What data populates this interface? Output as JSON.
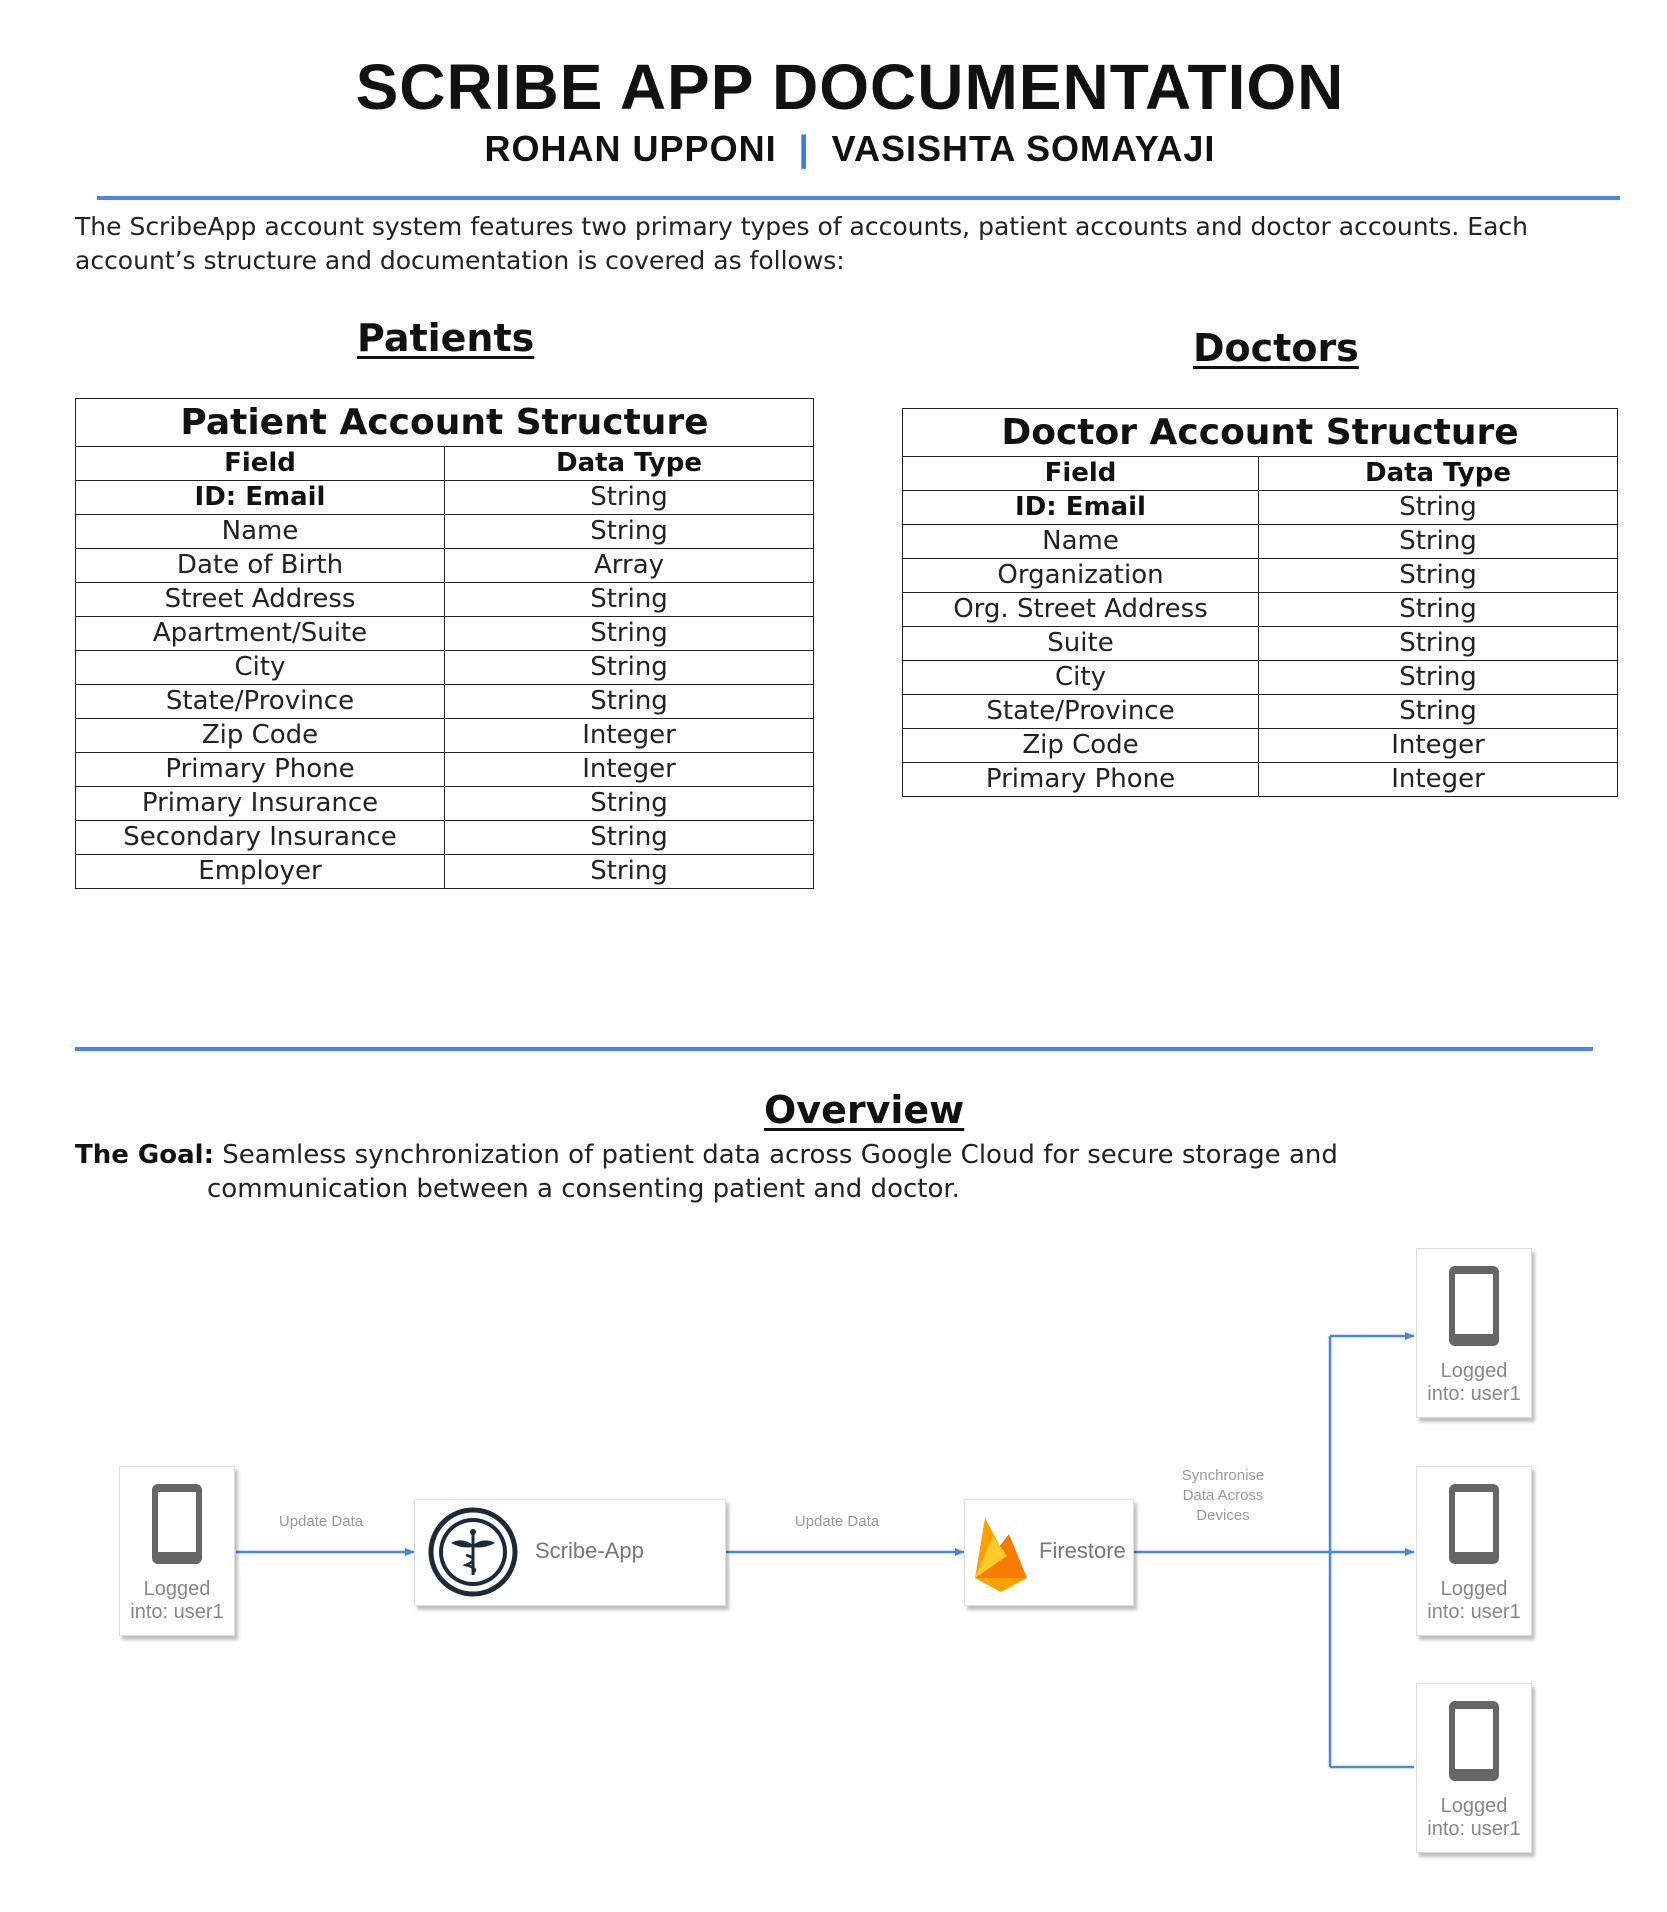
{
  "header": {
    "title": "SCRIBE APP DOCUMENTATION",
    "author1": "ROHAN UPPONI",
    "separator": "|",
    "author2": "VASISHTA SOMAYAJI"
  },
  "intro": "The ScribeApp account system features two primary types of accounts, patient accounts and doctor accounts. Each account’s structure and documentation is covered as follows:",
  "patients": {
    "heading": "Patients",
    "table_title": "Patient Account Structure",
    "col_field": "Field",
    "col_type": "Data Type",
    "rows": [
      {
        "field": "ID: Email",
        "type": "String"
      },
      {
        "field": "Name",
        "type": "String"
      },
      {
        "field": "Date of Birth",
        "type": "Array"
      },
      {
        "field": "Street Address",
        "type": "String"
      },
      {
        "field": "Apartment/Suite",
        "type": "String"
      },
      {
        "field": "City",
        "type": "String"
      },
      {
        "field": "State/Province",
        "type": "String"
      },
      {
        "field": "Zip Code",
        "type": "Integer"
      },
      {
        "field": "Primary Phone",
        "type": "Integer"
      },
      {
        "field": "Primary Insurance",
        "type": "String"
      },
      {
        "field": "Secondary Insurance",
        "type": "String"
      },
      {
        "field": "Employer",
        "type": "String"
      }
    ]
  },
  "doctors": {
    "heading": "Doctors",
    "table_title": "Doctor Account Structure",
    "col_field": "Field",
    "col_type": "Data Type",
    "rows": [
      {
        "field": "ID: Email",
        "type": "String"
      },
      {
        "field": "Name",
        "type": "String"
      },
      {
        "field": "Organization",
        "type": "String"
      },
      {
        "field": "Org. Street Address",
        "type": "String"
      },
      {
        "field": "Suite",
        "type": "String"
      },
      {
        "field": "City",
        "type": "String"
      },
      {
        "field": "State/Province",
        "type": "String"
      },
      {
        "field": "Zip Code",
        "type": "Integer"
      },
      {
        "field": "Primary Phone",
        "type": "Integer"
      }
    ]
  },
  "overview": {
    "heading": "Overview",
    "goal_label": "The Goal:",
    "goal_line1": "Seamless synchronization of patient data across Google Cloud for secure storage and",
    "goal_line2": "communication between a consenting patient and doctor."
  },
  "diagram": {
    "source_device": {
      "line1": "Logged",
      "line2": "into: user1",
      "icon": "phone-icon"
    },
    "edge1_label": "Update Data",
    "app_node": {
      "label": "Scribe-App",
      "icon": "caduceus-icon"
    },
    "edge2_label": "Update Data",
    "store_node": {
      "label": "Firestore",
      "icon": "firebase-flame-icon"
    },
    "edge3_label": [
      "Synchronise",
      "Data Across",
      "Devices"
    ],
    "target_devices": [
      {
        "line1": "Logged",
        "line2": "into: user1",
        "icon": "phone-icon"
      },
      {
        "line1": "Logged",
        "line2": "into: user1",
        "icon": "phone-icon"
      },
      {
        "line1": "Logged",
        "line2": "into: user1",
        "icon": "phone-icon"
      }
    ],
    "colors": {
      "edge": "#4a86e8",
      "phone": "#666666",
      "rule": "#4a86e8"
    }
  }
}
